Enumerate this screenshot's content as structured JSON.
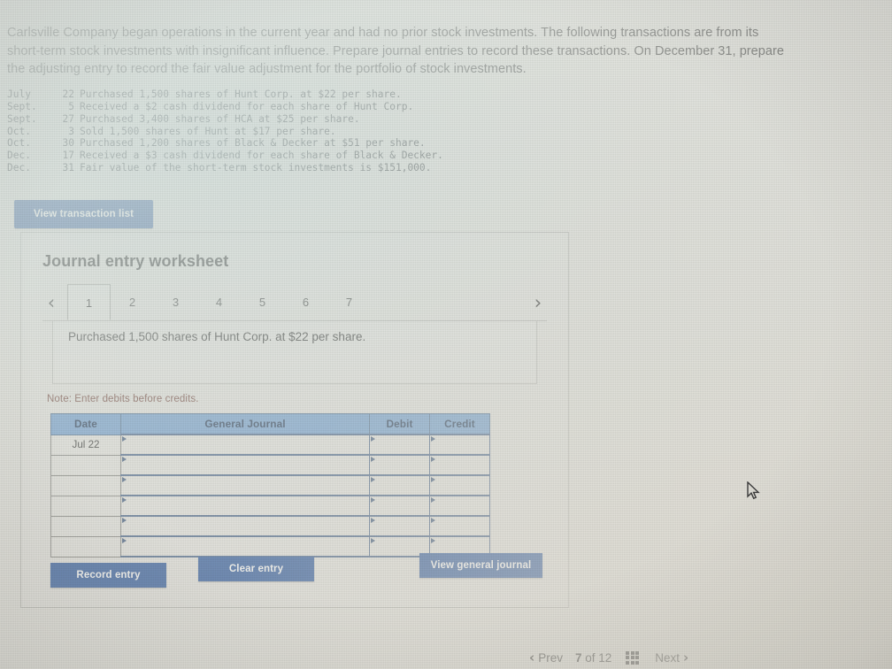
{
  "problem": {
    "statement": "Carlsville Company began operations in the current year and had no prior stock investments. The following transactions are from its short-term stock investments with insignificant influence. Prepare journal entries to record these transactions. On December 31, prepare the adjusting entry to record the fair value adjustment for the portfolio of stock investments."
  },
  "transactions": [
    {
      "month": "July",
      "day": "22",
      "description": "Purchased 1,500 shares of Hunt Corp. at $22 per share."
    },
    {
      "month": "Sept.",
      "day": "5",
      "description": "Received a $2 cash dividend for each share of Hunt Corp."
    },
    {
      "month": "Sept.",
      "day": "27",
      "description": "Purchased 3,400 shares of HCA at $25 per share."
    },
    {
      "month": "Oct.",
      "day": "3",
      "description": "Sold 1,500 shares of Hunt at $17 per share."
    },
    {
      "month": "Oct.",
      "day": "30",
      "description": "Purchased 1,200 shares of Black & Decker at $51 per share."
    },
    {
      "month": "Dec.",
      "day": "17",
      "description": "Received a $3 cash dividend for each share of Black & Decker."
    },
    {
      "month": "Dec.",
      "day": "31",
      "description": "Fair value of the short-term stock investments is $151,000."
    }
  ],
  "toolbar": {
    "view_transaction_list_label": "View transaction list"
  },
  "worksheet": {
    "title": "Journal entry worksheet",
    "prev_chevron": "‹",
    "next_chevron": "›",
    "tabs": [
      {
        "label": "1",
        "active": true
      },
      {
        "label": "2",
        "active": false
      },
      {
        "label": "3",
        "active": false
      },
      {
        "label": "4",
        "active": false
      },
      {
        "label": "5",
        "active": false
      },
      {
        "label": "6",
        "active": false
      },
      {
        "label": "7",
        "active": false
      }
    ],
    "prompt": "Purchased 1,500 shares of Hunt Corp. at $22 per share.",
    "note": "Note: Enter debits before credits.",
    "table": {
      "headers": [
        "Date",
        "General Journal",
        "Debit",
        "Credit"
      ],
      "rows": [
        {
          "date": "Jul 22",
          "journal": "",
          "debit": "",
          "credit": ""
        },
        {
          "date": "",
          "journal": "",
          "debit": "",
          "credit": ""
        },
        {
          "date": "",
          "journal": "",
          "debit": "",
          "credit": ""
        },
        {
          "date": "",
          "journal": "",
          "debit": "",
          "credit": ""
        },
        {
          "date": "",
          "journal": "",
          "debit": "",
          "credit": ""
        },
        {
          "date": "",
          "journal": "",
          "debit": "",
          "credit": ""
        }
      ]
    },
    "actions": {
      "record_entry_label": "Record entry",
      "clear_entry_label": "Clear entry",
      "view_general_journal_label": "View general journal"
    }
  },
  "pager": {
    "prev_chevron": "‹",
    "prev_label": "Prev",
    "current": "7",
    "of_label": "of",
    "total": "12",
    "grid_icon": "grid-icon",
    "next_label": "Next",
    "next_chevron": "›"
  },
  "colors": {
    "button_blue": "#21509a",
    "table_header_blue": "#6a9bd0",
    "note_red": "#6a3a32",
    "page_background": "#e3e2dd"
  }
}
